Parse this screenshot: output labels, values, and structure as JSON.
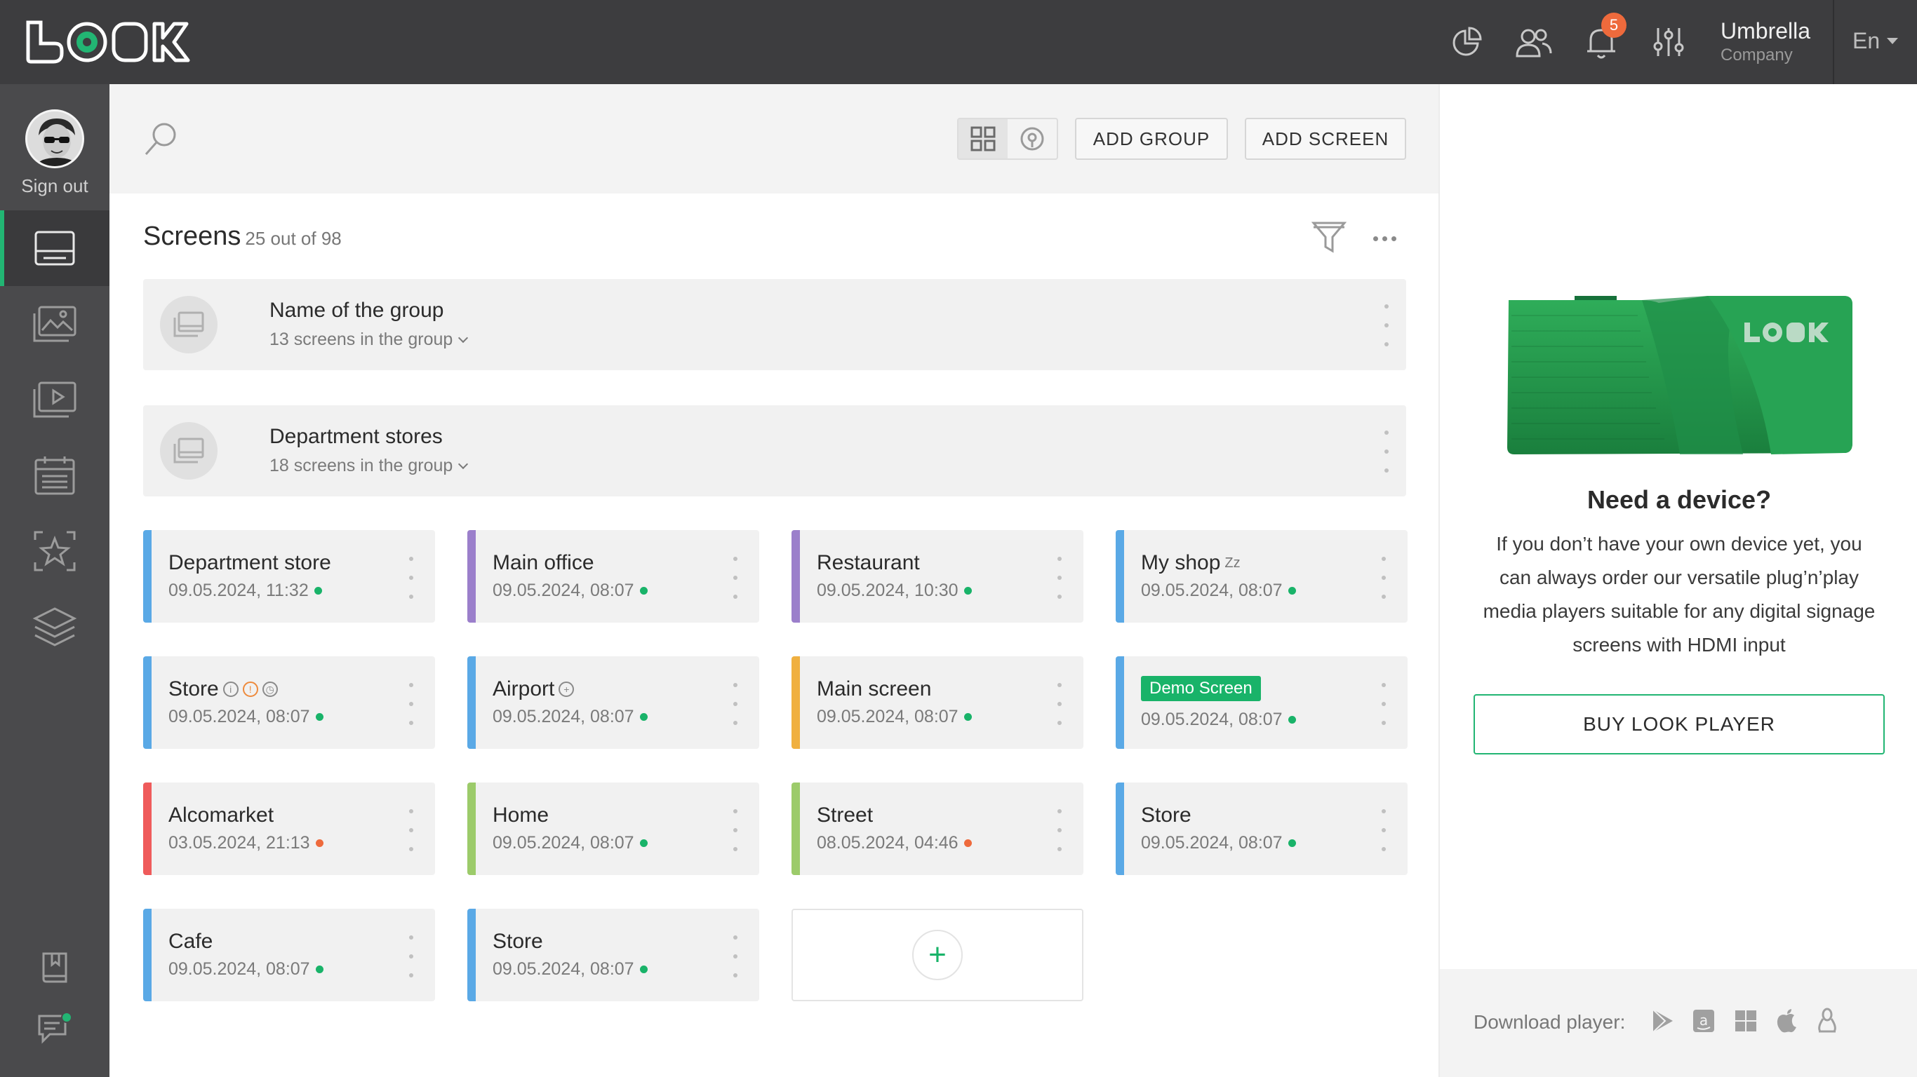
{
  "app": {
    "logo_text": "LOOK"
  },
  "topbar": {
    "notifications_count": "5",
    "company_name": "Umbrella",
    "company_sub": "Company",
    "language": "En",
    "icons": [
      "pie-chart-icon",
      "users-icon",
      "bell-icon",
      "sliders-icon"
    ]
  },
  "sidebar": {
    "sign_out": "Sign out",
    "items": [
      {
        "icon": "screen-icon",
        "active": true
      },
      {
        "icon": "image-icon"
      },
      {
        "icon": "playlist-icon"
      },
      {
        "icon": "calendar-icon"
      },
      {
        "icon": "star-icon"
      },
      {
        "icon": "layers-icon"
      }
    ],
    "bottom_items": [
      "book-icon",
      "chat-icon"
    ]
  },
  "toolbar": {
    "add_group": "ADD GROUP",
    "add_screen": "ADD SCREEN"
  },
  "screens": {
    "title": "Screens",
    "count": "25 out of 98"
  },
  "groups": [
    {
      "name": "Name of the group",
      "sub": "13 screens in the group"
    },
    {
      "name": "Department stores",
      "sub": "18 screens in the group"
    }
  ],
  "cards": [
    {
      "name": "Department store",
      "date": "09.05.2024, 11:32",
      "bar": "#5aa9e6",
      "status": "#19b369"
    },
    {
      "name": "Main office",
      "date": "09.05.2024, 08:07",
      "bar": "#9b7fcb",
      "status": "#19b369"
    },
    {
      "name": "Restaurant",
      "date": "09.05.2024, 10:30",
      "bar": "#9b7fcb",
      "status": "#19b369"
    },
    {
      "name": "My shop",
      "extra": "Zz",
      "date": "09.05.2024, 08:07",
      "bar": "#5aa9e6",
      "status": "#19b369"
    },
    {
      "name": "Store",
      "date": "09.05.2024, 08:07",
      "bar": "#5aa9e6",
      "status": "#19b369"
    },
    {
      "name": "Airport",
      "date": "09.05.2024, 08:07",
      "bar": "#5aa9e6",
      "status": "#19b369"
    },
    {
      "name": "Main screen",
      "date": "09.05.2024, 08:07",
      "bar": "#f0b040",
      "status": "#19b369"
    },
    {
      "name": "Demo Screen",
      "date": "09.05.2024, 08:07",
      "bar": "#5aa9e6",
      "status": "#19b369"
    },
    {
      "name": "Alcomarket",
      "date": "03.05.2024, 21:13",
      "bar": "#ef5b5b",
      "status": "#ee6a3c"
    },
    {
      "name": "Home",
      "date": "09.05.2024, 08:07",
      "bar": "#9ccb6a",
      "status": "#19b369"
    },
    {
      "name": "Street",
      "date": "08.05.2024, 04:46",
      "bar": "#9ccb6a",
      "status": "#ee6a3c"
    },
    {
      "name": "Store",
      "date": "09.05.2024, 08:07",
      "bar": "#5aa9e6",
      "status": "#19b369"
    },
    {
      "name": "Cafe",
      "date": "09.05.2024, 08:07",
      "bar": "#5aa9e6",
      "status": "#19b369"
    },
    {
      "name": "Store",
      "date": "09.05.2024, 08:07",
      "bar": "#5aa9e6",
      "status": "#19b369"
    }
  ],
  "right_panel": {
    "title": "Need a device?",
    "text": "If you don’t have your own device yet, you can always order our versatile plug’n’play media players suitable for any digital signage screens with HDMI input",
    "buy_button": "BUY LOOK PLAYER",
    "download_label": "Download player:",
    "platforms": [
      "google-play-icon",
      "amazon-icon",
      "windows-icon",
      "apple-icon",
      "linux-icon"
    ]
  },
  "colors": {
    "accent": "#22b573",
    "topbar": "#3d3d3f",
    "sidebar": "#4a4a4c"
  }
}
